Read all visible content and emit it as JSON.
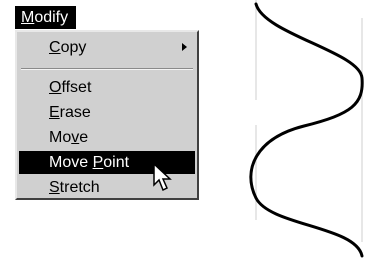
{
  "menu": {
    "title_mnemonic": "M",
    "title_rest": "odify",
    "items": [
      {
        "pre": "",
        "key": "C",
        "post": "opy",
        "has_submenu": true
      },
      {
        "pre": "",
        "key": "O",
        "post": "ffset"
      },
      {
        "pre": "",
        "key": "E",
        "post": "rase"
      },
      {
        "pre": "Mo",
        "key": "v",
        "post": "e"
      },
      {
        "pre": "Move ",
        "key": "P",
        "post": "oint",
        "selected": true
      },
      {
        "pre": "",
        "key": "S",
        "post": "tretch"
      }
    ]
  },
  "icons": {
    "submenu_arrow": "triangle-right-icon",
    "cursor": "arrow-pointer-icon"
  },
  "colors": {
    "menu_bg": "#d0d0d0",
    "highlight": "#000000",
    "highlight_text": "#ffffff"
  }
}
